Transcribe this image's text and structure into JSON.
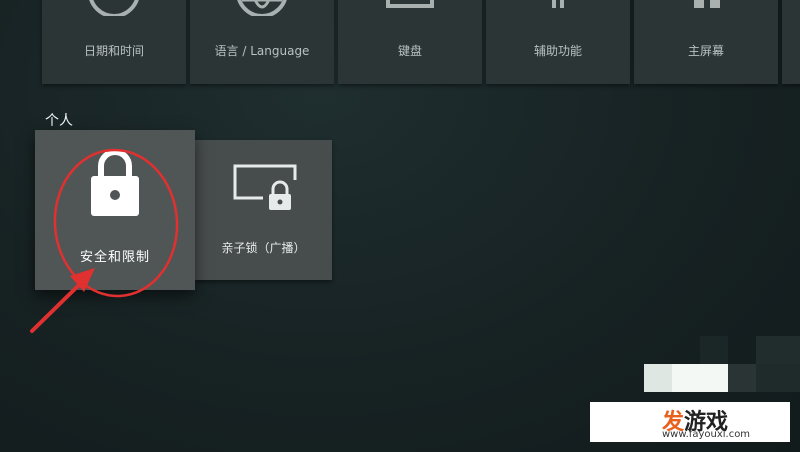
{
  "top_row": [
    {
      "label": "日期和时间",
      "icon": "clock-icon"
    },
    {
      "label": "语言 / Language",
      "icon": "globe-icon"
    },
    {
      "label": "键盘",
      "icon": "keyboard-icon"
    },
    {
      "label": "辅助功能",
      "icon": "accessibility-icon"
    },
    {
      "label": "主屏幕",
      "icon": "home-screen-icon"
    }
  ],
  "personal": {
    "title": "个人",
    "items": [
      {
        "label": "安全和限制",
        "icon": "lock-icon"
      },
      {
        "label": "亲子锁（广播）",
        "icon": "screen-lock-icon"
      }
    ]
  },
  "annotation": {
    "color": "#e0302f"
  },
  "watermark": {
    "text_accent": "发",
    "text_rest": "游戏",
    "url": "www.fayouxi.com"
  },
  "colors": {
    "background": "#172223",
    "tile": "#2b3535",
    "focused_tile": "#505656"
  }
}
